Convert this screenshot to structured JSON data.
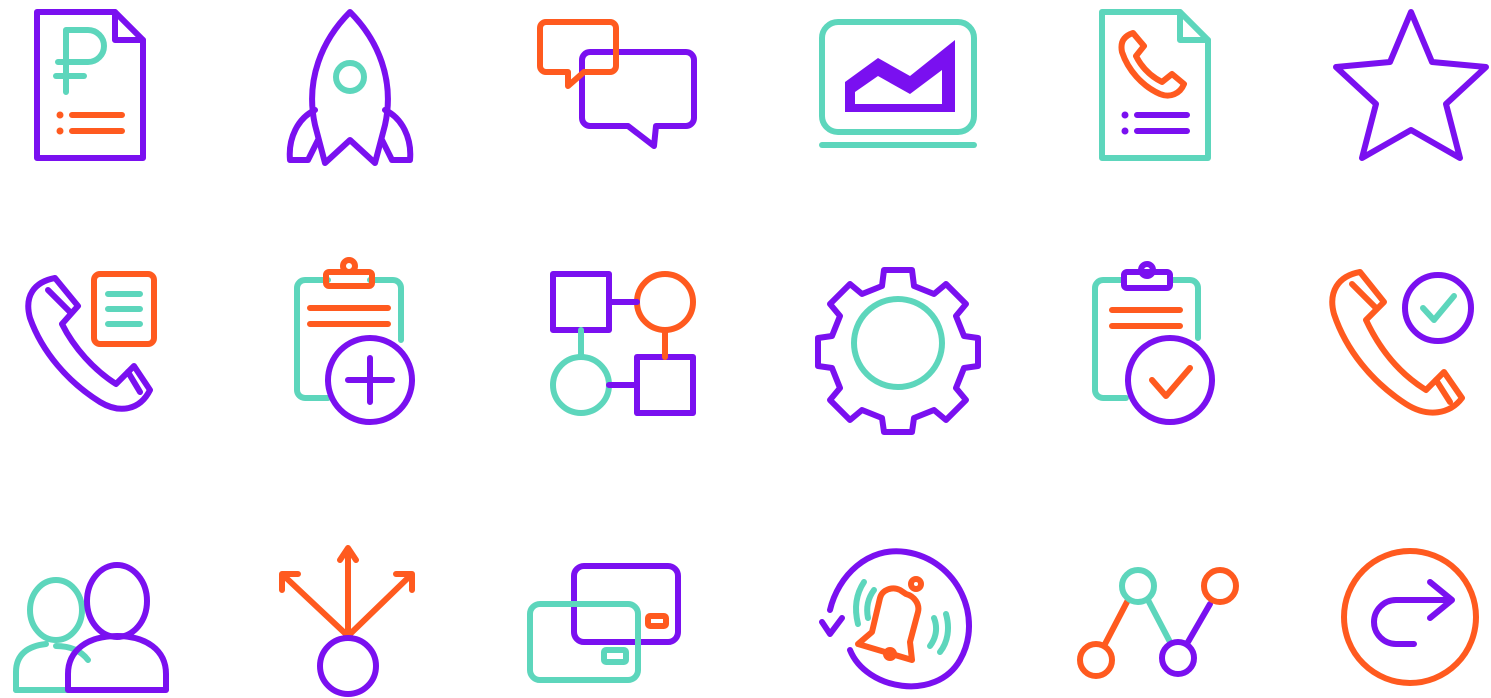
{
  "palette": {
    "purple": "#7a10f0",
    "teal": "#5dd6bc",
    "orange": "#ff5a1f",
    "background": "#ffffff"
  },
  "icons": [
    {
      "name": "ruble-invoice-icon"
    },
    {
      "name": "rocket-icon"
    },
    {
      "name": "chat-bubbles-icon"
    },
    {
      "name": "laptop-chart-icon"
    },
    {
      "name": "phone-document-icon"
    },
    {
      "name": "star-icon"
    },
    {
      "name": "phone-note-icon"
    },
    {
      "name": "clipboard-add-icon"
    },
    {
      "name": "flowchart-icon"
    },
    {
      "name": "gear-icon"
    },
    {
      "name": "clipboard-check-icon"
    },
    {
      "name": "phone-check-icon"
    },
    {
      "name": "users-icon"
    },
    {
      "name": "split-arrows-icon"
    },
    {
      "name": "cards-icon"
    },
    {
      "name": "bell-refresh-icon"
    },
    {
      "name": "path-nodes-icon"
    },
    {
      "name": "redirect-arrow-icon"
    }
  ]
}
